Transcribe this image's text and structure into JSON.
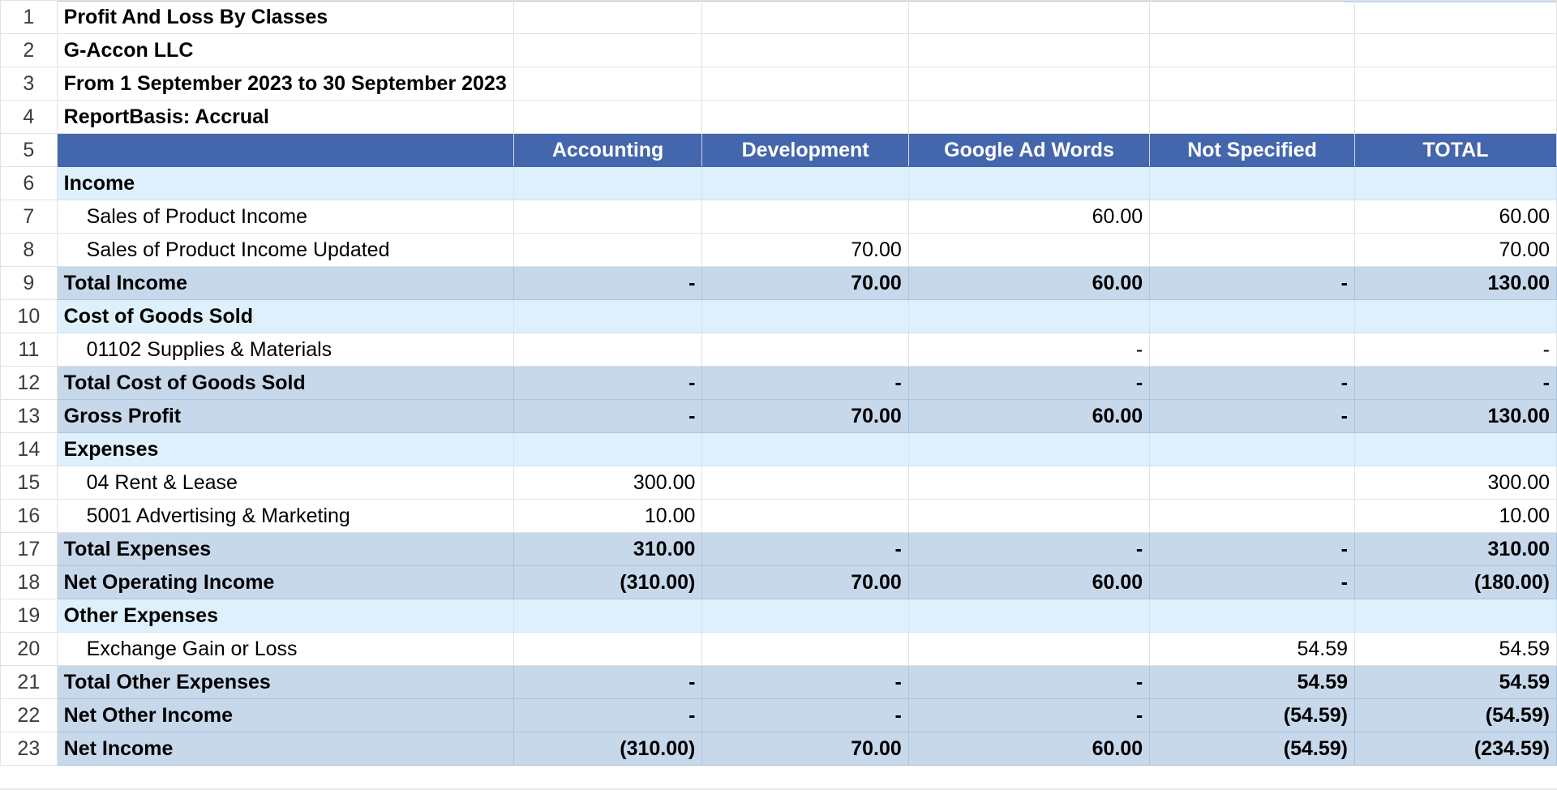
{
  "report": {
    "title": "Profit And Loss By Classes",
    "company": "G-Accon LLC",
    "period": "From 1 September 2023 to 30 September 2023",
    "basis": "ReportBasis: Accrual"
  },
  "columns": [
    "Accounting",
    "Development",
    "Google Ad Words",
    "Not Specified",
    "TOTAL"
  ],
  "rows": [
    {
      "n": "1",
      "type": "title",
      "label": "Profit And Loss By Classes",
      "vals": [
        "",
        "",
        "",
        "",
        ""
      ]
    },
    {
      "n": "2",
      "type": "title",
      "label": "G-Accon LLC",
      "vals": [
        "",
        "",
        "",
        "",
        ""
      ]
    },
    {
      "n": "3",
      "type": "title",
      "label": "From 1 September 2023 to 30 September 2023",
      "vals": [
        "",
        "",
        "",
        "",
        ""
      ]
    },
    {
      "n": "4",
      "type": "title",
      "label": "ReportBasis: Accrual",
      "vals": [
        "",
        "",
        "",
        "",
        ""
      ]
    },
    {
      "n": "5",
      "type": "header",
      "label": "",
      "vals": [
        "Accounting",
        "Development",
        "Google Ad Words",
        "Not Specified",
        "TOTAL"
      ]
    },
    {
      "n": "6",
      "type": "section",
      "label": "Income",
      "vals": [
        "",
        "",
        "",
        "",
        ""
      ]
    },
    {
      "n": "7",
      "type": "detail",
      "label": "Sales of Product Income",
      "vals": [
        "",
        "",
        "60.00",
        "",
        "60.00"
      ]
    },
    {
      "n": "8",
      "type": "detail",
      "label": "Sales of Product Income Updated",
      "vals": [
        "",
        "70.00",
        "",
        "",
        "70.00"
      ]
    },
    {
      "n": "9",
      "type": "total",
      "label": "Total Income",
      "vals": [
        "-",
        "70.00",
        "60.00",
        "-",
        "130.00"
      ]
    },
    {
      "n": "10",
      "type": "section",
      "label": "Cost of Goods Sold",
      "vals": [
        "",
        "",
        "",
        "",
        ""
      ]
    },
    {
      "n": "11",
      "type": "detail",
      "label": "01102 Supplies & Materials",
      "vals": [
        "",
        "",
        "-",
        "",
        "-"
      ]
    },
    {
      "n": "12",
      "type": "total",
      "label": "Total Cost of Goods Sold",
      "vals": [
        "-",
        "-",
        "-",
        "-",
        "-"
      ]
    },
    {
      "n": "13",
      "type": "total",
      "label": "Gross Profit",
      "vals": [
        "-",
        "70.00",
        "60.00",
        "-",
        "130.00"
      ]
    },
    {
      "n": "14",
      "type": "section",
      "label": "Expenses",
      "vals": [
        "",
        "",
        "",
        "",
        ""
      ]
    },
    {
      "n": "15",
      "type": "detail",
      "label": "04 Rent & Lease",
      "vals": [
        "300.00",
        "",
        "",
        "",
        "300.00"
      ]
    },
    {
      "n": "16",
      "type": "detail",
      "label": "5001 Advertising & Marketing",
      "vals": [
        "10.00",
        "",
        "",
        "",
        "10.00"
      ]
    },
    {
      "n": "17",
      "type": "total",
      "label": "Total Expenses",
      "vals": [
        "310.00",
        "-",
        "-",
        "-",
        "310.00"
      ]
    },
    {
      "n": "18",
      "type": "total",
      "label": "Net Operating Income",
      "vals": [
        "(310.00)",
        "70.00",
        "60.00",
        "-",
        "(180.00)"
      ]
    },
    {
      "n": "19",
      "type": "section",
      "label": "Other Expenses",
      "vals": [
        "",
        "",
        "",
        "",
        ""
      ]
    },
    {
      "n": "20",
      "type": "detail",
      "label": "Exchange Gain or Loss",
      "vals": [
        "",
        "",
        "",
        "54.59",
        "54.59"
      ]
    },
    {
      "n": "21",
      "type": "total",
      "label": "Total Other Expenses",
      "vals": [
        "-",
        "-",
        "-",
        "54.59",
        "54.59"
      ]
    },
    {
      "n": "22",
      "type": "total",
      "label": "Net Other Income",
      "vals": [
        "-",
        "-",
        "-",
        "(54.59)",
        "(54.59)"
      ]
    },
    {
      "n": "23",
      "type": "total",
      "label": "Net Income",
      "vals": [
        "(310.00)",
        "70.00",
        "60.00",
        "(54.59)",
        "(234.59)"
      ]
    }
  ]
}
